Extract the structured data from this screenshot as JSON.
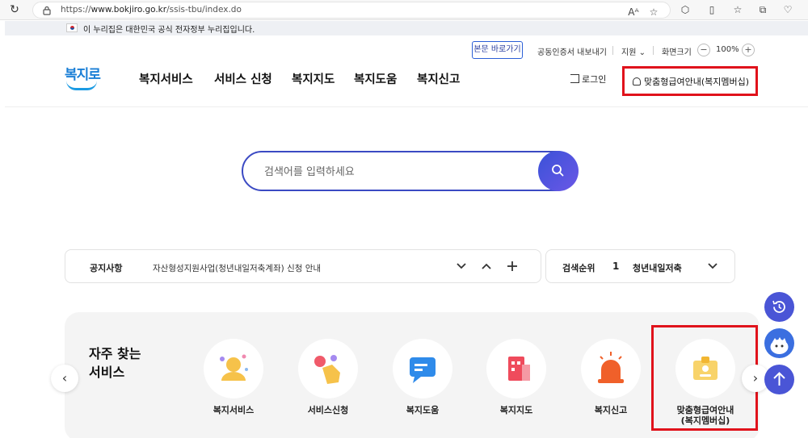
{
  "browser": {
    "url_prefix": "https://",
    "url_domain": "www.bokjiro.go.kr",
    "url_path": "/ssis-tbu/index.do"
  },
  "gov_banner": {
    "text": "이 누리집은 대한민국 공식 전자정부 누리집입니다."
  },
  "header": {
    "skip_link": "본문 바로가기",
    "cert_export": "공동인증서 내보내기",
    "support": "지원",
    "screen_size": "화면크기",
    "zoom_value": "100%",
    "logo_text": "복지로",
    "nav": [
      "복지서비스",
      "서비스 신청",
      "복지지도",
      "복지도움",
      "복지신고"
    ],
    "login": "로그인",
    "member": "맞춤형급여안내(복지멤버십)"
  },
  "search": {
    "placeholder": "검색어를 입력하세요"
  },
  "notice": {
    "label": "공지사항",
    "text": "자산형성지원사업(청년내일저축계좌) 신청 안내"
  },
  "rank": {
    "label": "검색순위",
    "number": "1",
    "term": "청년내일저축"
  },
  "frequent": {
    "title": "자주 찾는 서비스",
    "items": [
      {
        "label": "복지서비스",
        "icon": "people-icon"
      },
      {
        "label": "서비스신청",
        "icon": "hand-touch-icon"
      },
      {
        "label": "복지도움",
        "icon": "chat-icon"
      },
      {
        "label": "복지지도",
        "icon": "map-icon"
      },
      {
        "label": "복지신고",
        "icon": "siren-icon"
      },
      {
        "label": "맞춤형급여안내\n(복지멤버십)",
        "icon": "id-card-icon"
      }
    ]
  },
  "colors": {
    "accent": "#3b4ac3",
    "highlight": "#e0121b",
    "brand": "#1b7fd6"
  }
}
